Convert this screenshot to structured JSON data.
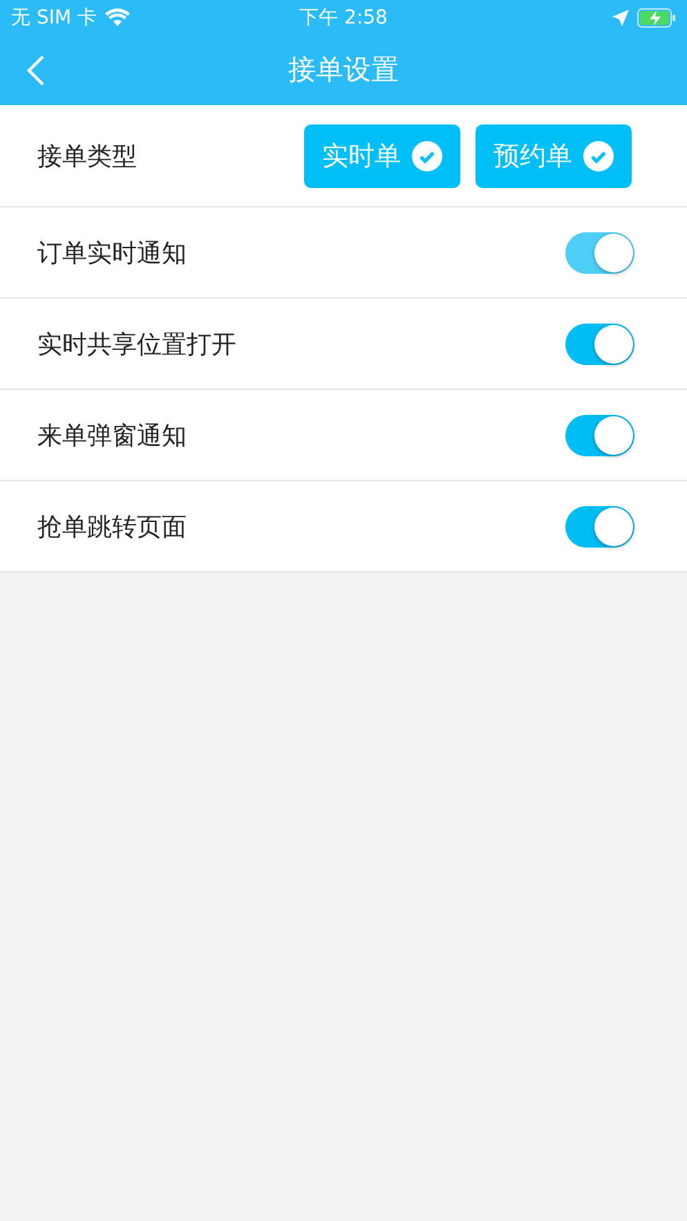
{
  "status_bar": {
    "carrier": "无 SIM 卡",
    "time": "下午 2:58"
  },
  "nav": {
    "title": "接单设置"
  },
  "order_type": {
    "label": "接单类型",
    "options": [
      {
        "label": "实时单",
        "checked": true
      },
      {
        "label": "预约单",
        "checked": true
      }
    ]
  },
  "settings": [
    {
      "label": "订单实时通知",
      "on": true,
      "disabled": true
    },
    {
      "label": "实时共享位置打开",
      "on": true,
      "disabled": false
    },
    {
      "label": "来单弹窗通知",
      "on": true,
      "disabled": false
    },
    {
      "label": "抢单跳转页面",
      "on": true,
      "disabled": false
    }
  ]
}
